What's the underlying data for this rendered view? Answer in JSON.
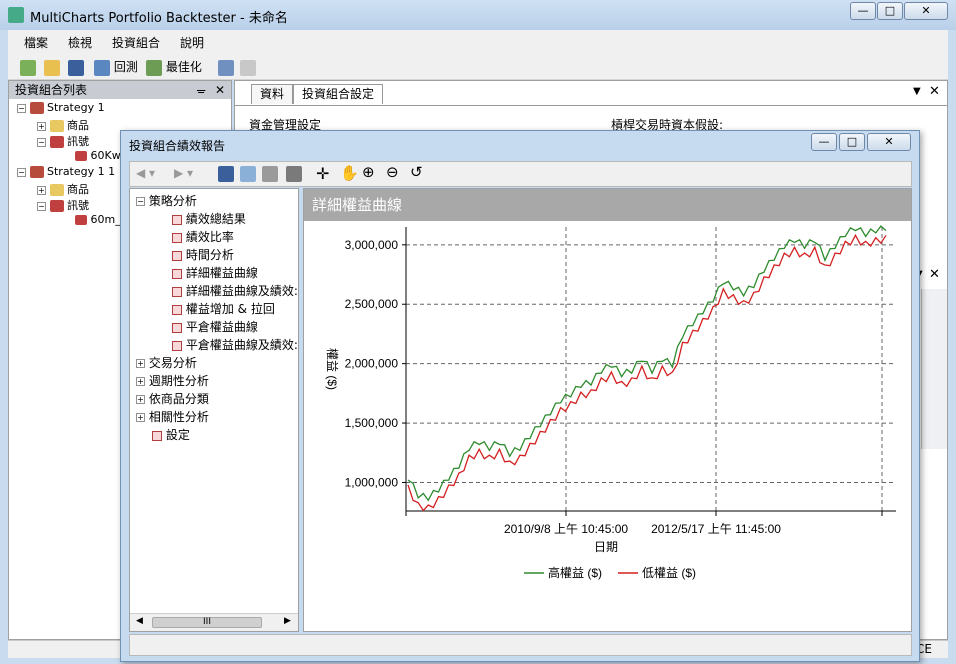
{
  "window": {
    "title": "MultiCharts Portfolio Backtester - 未命名"
  },
  "menu": [
    "檔案",
    "檢視",
    "投資組合",
    "說明"
  ],
  "toolbar": {
    "backtest": "回測",
    "optimize": "最佳化"
  },
  "left_panel": {
    "title": "投資組合列表",
    "strategies": [
      {
        "name": "Strategy 1",
        "items": [
          "商品",
          "訊號"
        ],
        "signal": "60Kw"
      },
      {
        "name": "Strategy 1 1",
        "items": [
          "商品",
          "訊號"
        ],
        "signal": "60m_"
      }
    ]
  },
  "right_panel": {
    "tabs": [
      "資料",
      "投資組合設定"
    ],
    "settings_label": "資金管理設定",
    "leverage_label": "槓桿交易時資本假設:"
  },
  "status": {
    "right_text": "CE"
  },
  "report": {
    "title": "投資組合績效報告",
    "tree": [
      {
        "label": "策略分析",
        "expanded": true,
        "children": [
          "績效總結果",
          "績效比率",
          "時間分析",
          "詳細權益曲線",
          "詳細權益曲線及績效:",
          "權益增加 & 拉回",
          "平倉權益曲線",
          "平倉權益曲線及績效:"
        ]
      },
      {
        "label": "交易分析",
        "expanded": false,
        "children": []
      },
      {
        "label": "週期性分析",
        "expanded": false,
        "children": []
      },
      {
        "label": "依商品分類",
        "expanded": false,
        "children": []
      },
      {
        "label": "相關性分析",
        "expanded": false,
        "children": []
      },
      {
        "label": "設定",
        "expanded": false,
        "children": []
      }
    ],
    "chart_title": "詳細權益曲線"
  },
  "chart_data": {
    "type": "line",
    "title": "詳細權益曲線",
    "xlabel": "日期",
    "ylabel": "權益 ($)",
    "x_tick_labels": [
      "2010/9/8 上午 10:45:00",
      "2012/5/17 上午 11:45:00"
    ],
    "y_ticks": [
      1000000,
      1500000,
      2000000,
      2500000,
      3000000
    ],
    "y_tick_labels": [
      "1,000,000",
      "1,500,000",
      "2,000,000",
      "2,500,000",
      "3,000,000"
    ],
    "ylim": [
      760000,
      3150000
    ],
    "grid": true,
    "legend_position": "bottom",
    "series": [
      {
        "name": "高權益 ($)",
        "color": "#2e8b2e"
      },
      {
        "name": "低權益 ($)",
        "color": "#d42020"
      }
    ],
    "points": [
      [
        0,
        1000000
      ],
      [
        2,
        850000
      ],
      [
        4,
        830000
      ],
      [
        6,
        900000
      ],
      [
        8,
        1000000
      ],
      [
        10,
        1100000
      ],
      [
        12,
        1250000
      ],
      [
        14,
        1300000
      ],
      [
        16,
        1250000
      ],
      [
        18,
        1300000
      ],
      [
        20,
        1200000
      ],
      [
        22,
        1250000
      ],
      [
        24,
        1350000
      ],
      [
        26,
        1450000
      ],
      [
        28,
        1550000
      ],
      [
        30,
        1650000
      ],
      [
        32,
        1700000
      ],
      [
        34,
        1780000
      ],
      [
        36,
        1800000
      ],
      [
        38,
        1900000
      ],
      [
        40,
        1950000
      ],
      [
        42,
        1870000
      ],
      [
        44,
        1900000
      ],
      [
        46,
        2000000
      ],
      [
        48,
        1900000
      ],
      [
        50,
        2000000
      ],
      [
        52,
        1950000
      ],
      [
        54,
        2200000
      ],
      [
        56,
        2300000
      ],
      [
        58,
        2400000
      ],
      [
        60,
        2500000
      ],
      [
        62,
        2650000
      ],
      [
        64,
        2600000
      ],
      [
        66,
        2550000
      ],
      [
        68,
        2620000
      ],
      [
        70,
        2750000
      ],
      [
        72,
        2850000
      ],
      [
        74,
        2950000
      ],
      [
        76,
        3000000
      ],
      [
        78,
        2950000
      ],
      [
        80,
        3000000
      ],
      [
        82,
        2850000
      ],
      [
        84,
        2950000
      ],
      [
        86,
        3050000
      ],
      [
        88,
        3100000
      ],
      [
        90,
        3050000
      ],
      [
        92,
        3080000
      ],
      [
        94,
        3100000
      ]
    ]
  }
}
